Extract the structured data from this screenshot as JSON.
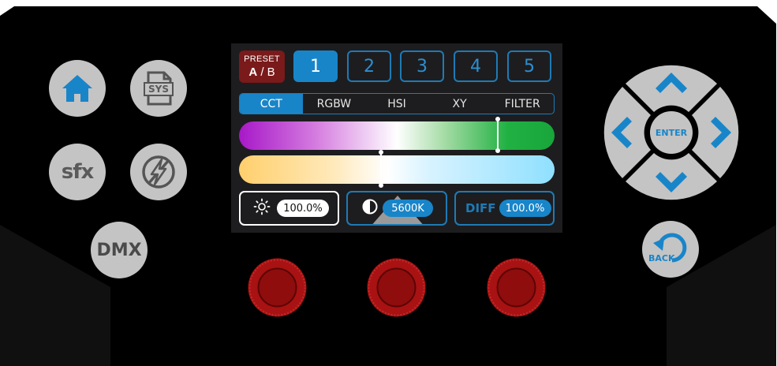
{
  "colors": {
    "panel": "#000000",
    "button_gray": "#c4c4c4",
    "button_blue": "#1985c9",
    "preset_red": "#7a1a1a",
    "knob_red": "#a81212"
  },
  "left_buttons": {
    "home_icon": "home-icon",
    "sys_label": "SYS",
    "sfx_label": "sfx",
    "power_icon": "lightning-power-icon",
    "dmx_label": "DMX"
  },
  "screen": {
    "preset": {
      "title": "PRESET",
      "active": "A",
      "separator": "/",
      "inactive": "B"
    },
    "presets": [
      "1",
      "2",
      "3",
      "4",
      "5"
    ],
    "active_preset": "1",
    "modes": [
      "CCT",
      "RGBW",
      "HSI",
      "XY",
      "FILTER"
    ],
    "active_mode": "CCT",
    "tint_position": 0.82,
    "cct_position": 0.45,
    "readouts": {
      "brightness_icon": "brightness-icon",
      "brightness": "100.0%",
      "cct_icon": "contrast-icon",
      "cct": "5600K",
      "diff_label": "DIFF",
      "diff": "100.0%"
    }
  },
  "right_buttons": {
    "up_icon": "chevron-up-icon",
    "down_icon": "chevron-down-icon",
    "left_icon": "chevron-left-icon",
    "right_icon": "chevron-right-icon",
    "enter_label": "ENTER",
    "back_label": "BACK"
  },
  "knobs": [
    "knob-left",
    "knob-center",
    "knob-right"
  ]
}
